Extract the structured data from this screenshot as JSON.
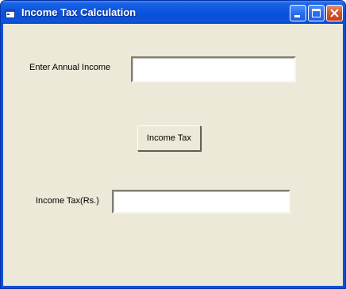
{
  "window": {
    "title": "Income Tax Calculation",
    "title_color": "#ffffff",
    "titlebar_color": "#0a55e0",
    "client_color": "#ece9d8"
  },
  "titlebar_buttons": {
    "minimize_icon": "minimize-icon",
    "maximize_icon": "maximize-icon",
    "close_icon": "close-icon"
  },
  "form": {
    "income_label": "Enter Annual Income",
    "income_value": "",
    "calc_button_label": "Income Tax",
    "tax_label": "Income Tax(Rs.)",
    "tax_value": ""
  }
}
